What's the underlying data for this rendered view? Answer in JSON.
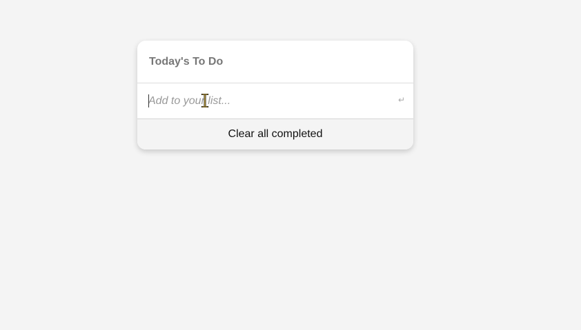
{
  "card": {
    "title": "Today's To Do"
  },
  "input": {
    "value": "",
    "placeholder": "Add to your list...",
    "enter_icon": "↵"
  },
  "footer": {
    "clear_label": "Clear all completed"
  },
  "icons": {
    "enter": "enter-icon",
    "cursor": "text-cursor-icon"
  }
}
